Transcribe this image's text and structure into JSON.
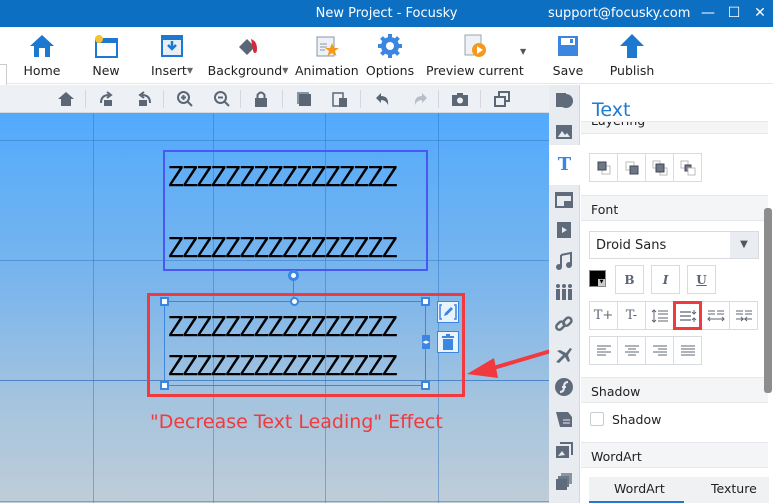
{
  "window": {
    "title": "New Project - Focusky",
    "account": "support@focusky.com",
    "controls": [
      "minimize",
      "maximize",
      "close"
    ]
  },
  "ribbon": {
    "buttons": [
      {
        "label": "Home",
        "icon": "home-icon"
      },
      {
        "label": "New",
        "icon": "new-icon"
      },
      {
        "label": "Insert",
        "icon": "insert-icon",
        "dropdown": true
      },
      {
        "label": "Background",
        "icon": "background-icon",
        "dropdown": true
      },
      {
        "label": "Animation",
        "icon": "animation-icon"
      },
      {
        "label": "Options",
        "icon": "gear-icon"
      },
      {
        "label": "Preview current",
        "icon": "preview-icon",
        "dropdown": true
      },
      {
        "label": "Save",
        "icon": "save-icon"
      },
      {
        "label": "Publish",
        "icon": "publish-icon"
      }
    ]
  },
  "canvas_toolbar": [
    "home",
    "rotate-right",
    "rotate-left",
    "zoom-in",
    "zoom-out",
    "lock",
    "copy",
    "paste",
    "undo",
    "redo",
    "screenshot",
    "window"
  ],
  "canvas": {
    "text_box_original": {
      "lines": [
        "ZZZZZZZZZZZZZZZZ",
        "ZZZZZZZZZZZZZZZZ"
      ]
    },
    "text_box_selected": {
      "lines": [
        "ZZZZZZZZZZZZZZZZ",
        "ZZZZZZZZZZZZZZZZ"
      ]
    },
    "caption": "\"Decrease Text Leading\" Effect",
    "highlight_color": "#f03a3e"
  },
  "panel": {
    "title": "Text",
    "sections": {
      "layering": "Layering",
      "font": "Font",
      "shadow": "Shadow",
      "wordart": "WordArt"
    },
    "font_family": "Droid Sans",
    "font_color": "#000000",
    "style_buttons": [
      "B",
      "I",
      "U"
    ],
    "size_buttons": [
      "T+",
      "T-"
    ],
    "shadow_checkbox_label": "Shadow",
    "shadow_checked": false,
    "wordart_tabs": [
      "WordArt",
      "Texture"
    ],
    "active_wordart_tab": "WordArt"
  },
  "colors": {
    "titlebar": "#0d6fc2",
    "accent": "#1f7ad1"
  }
}
